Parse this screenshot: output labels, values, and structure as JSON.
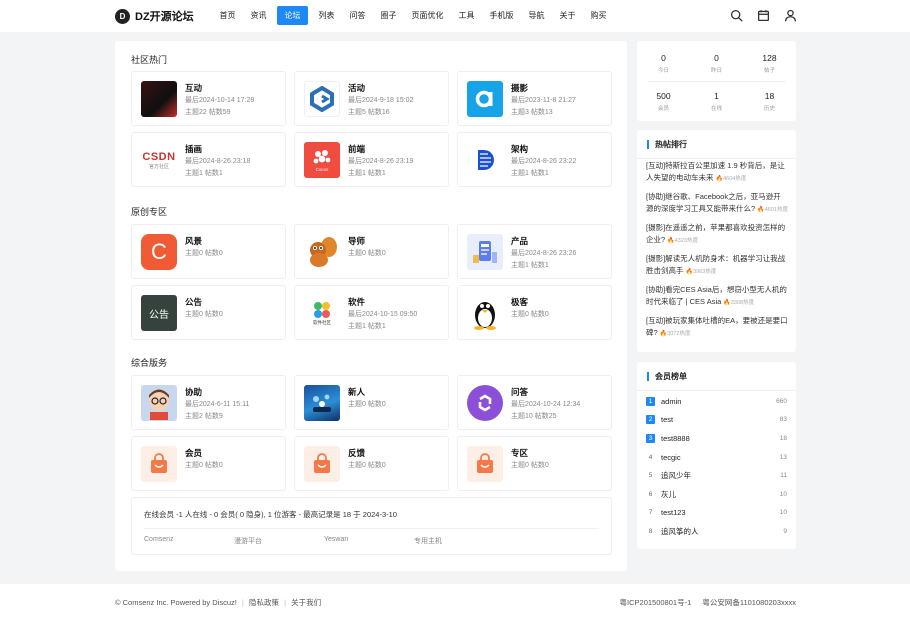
{
  "header": {
    "logo_text": "DZ开源论坛",
    "nav": [
      "首页",
      "资讯",
      "论坛",
      "列表",
      "问答",
      "圈子",
      "页面优化",
      "工具",
      "手机版",
      "导航",
      "关于",
      "购买"
    ],
    "active_nav": "论坛",
    "accent_color": "#1e88f7",
    "icons": [
      "search-icon",
      "calendar-icon",
      "user-icon"
    ]
  },
  "sections": [
    {
      "title": "社区热门",
      "forums": [
        {
          "name": "互动",
          "last": "最后2024-10-14 17:28",
          "stats": "主题22   帖数59",
          "icon": "dark-abstract"
        },
        {
          "name": "活动",
          "last": "最后2024-9-18 15:02",
          "stats": "主题5   帖数16",
          "icon": "blue-g-logo"
        },
        {
          "name": "摄影",
          "last": "最后2023-11-8 21:27",
          "stats": "主题3   帖数13",
          "icon": "blue-a-logo"
        },
        {
          "name": "插画",
          "last": "最后2024-8-26 23:18",
          "stats": "主题1   帖数1",
          "icon": "csdn-logo"
        },
        {
          "name": "前端",
          "last": "最后2024-8-26 23:19",
          "stats": "主题1   帖数1",
          "icon": "cocos-logo"
        },
        {
          "name": "架构",
          "last": "最后2024-8-26 23:22",
          "stats": "主题1   帖数1",
          "icon": "blue-d-logo"
        }
      ]
    },
    {
      "title": "原创专区",
      "forums": [
        {
          "name": "风景",
          "last": "",
          "stats": "主题0   帖数0",
          "icon": "orange-c-logo"
        },
        {
          "name": "导师",
          "last": "",
          "stats": "主题0   帖数0",
          "icon": "squirrel-logo"
        },
        {
          "name": "产品",
          "last": "最后2024-8-26 23:26",
          "stats": "主题1   帖数1",
          "icon": "product-illustration"
        },
        {
          "name": "公告",
          "last": "",
          "stats": "主题0   帖数0",
          "icon": "notice-logo"
        },
        {
          "name": "软件",
          "last": "最后2024-10-15 09:50",
          "stats": "主题1   帖数1",
          "icon": "software-logo"
        },
        {
          "name": "极客",
          "last": "",
          "stats": "主题0   帖数0",
          "icon": "penguin-logo"
        }
      ]
    },
    {
      "title": "综合版务",
      "forums": [
        {
          "name": "协助",
          "last": "最后2024-6-11 15:11",
          "stats": "主题2   帖数9",
          "icon": "avatar-glasses"
        },
        {
          "name": "新人",
          "last": "",
          "stats": "主题0   帖数0",
          "icon": "blue-scene"
        },
        {
          "name": "问答",
          "last": "最后2024-10-24 12:34",
          "stats": "主题10   帖数25",
          "icon": "purple-chain-logo"
        },
        {
          "name": "会员",
          "last": "",
          "stats": "主题0   帖数0",
          "icon": "shopping-bag-icon"
        },
        {
          "name": "反馈",
          "last": "",
          "stats": "主题0   帖数0",
          "icon": "shopping-bag-icon"
        },
        {
          "name": "专区",
          "last": "",
          "stats": "主题0   帖数0",
          "icon": "shopping-bag-icon"
        }
      ]
    }
  ],
  "online": {
    "text": "在线会员 -1 人在线 - 0 会员( 0 隐身), 1 位游客 - 最高记录是 18 于 2024-3-10",
    "links": [
      "Comsenz",
      "漫游平台",
      "Yeswan",
      "专用主机"
    ]
  },
  "stats": [
    {
      "value": "0",
      "label": "今日"
    },
    {
      "value": "0",
      "label": "昨日"
    },
    {
      "value": "128",
      "label": "帖子"
    },
    {
      "value": "500",
      "label": "会员"
    },
    {
      "value": "1",
      "label": "在线"
    },
    {
      "value": "18",
      "label": "历史"
    }
  ],
  "hot": {
    "title": "热帖排行",
    "items": [
      {
        "text": "[互动]特斯拉百公里加速 1.9 秒背后，是让人失望的电动车未来",
        "heat": "4604热度"
      },
      {
        "text": "[协助]继谷歌、Facebook之后，亚马逊开源的深度学习工具又能带来什么?",
        "heat": "4601热度"
      },
      {
        "text": "[摄影]在遥遥之前，苹果都喜欢投资怎样的企业?",
        "heat": "4323热度"
      },
      {
        "text": "[摄影]解读无人机防身术：机器学习让我战胜击剑高手",
        "heat": "3963热度"
      },
      {
        "text": "[协助]看完CES Asia后，想窃小型无人机的时代来临了 | CES Asia",
        "heat": "3308热度"
      },
      {
        "text": "[互动]被玩家集体吐槽的EA，要被还是要口碑?",
        "heat": "3072热度"
      }
    ]
  },
  "ranking": {
    "title": "会员榜单",
    "items": [
      {
        "rank": "1",
        "name": "admin",
        "value": "660"
      },
      {
        "rank": "2",
        "name": "test",
        "value": "83"
      },
      {
        "rank": "3",
        "name": "test8888",
        "value": "18"
      },
      {
        "rank": "4",
        "name": "tecgic",
        "value": "13"
      },
      {
        "rank": "5",
        "name": "追风少年",
        "value": "11"
      },
      {
        "rank": "6",
        "name": "灰儿",
        "value": "10"
      },
      {
        "rank": "7",
        "name": "test123",
        "value": "10"
      },
      {
        "rank": "8",
        "name": "追风筝的人",
        "value": "9"
      }
    ]
  },
  "footer": {
    "copyright": "© Comsenz Inc. Powered by Discuz!",
    "links": [
      "隐私政策",
      "关于我们"
    ],
    "icp": "粤ICP201500801号-1",
    "police": "粤公安网备1101080203xxxx"
  }
}
